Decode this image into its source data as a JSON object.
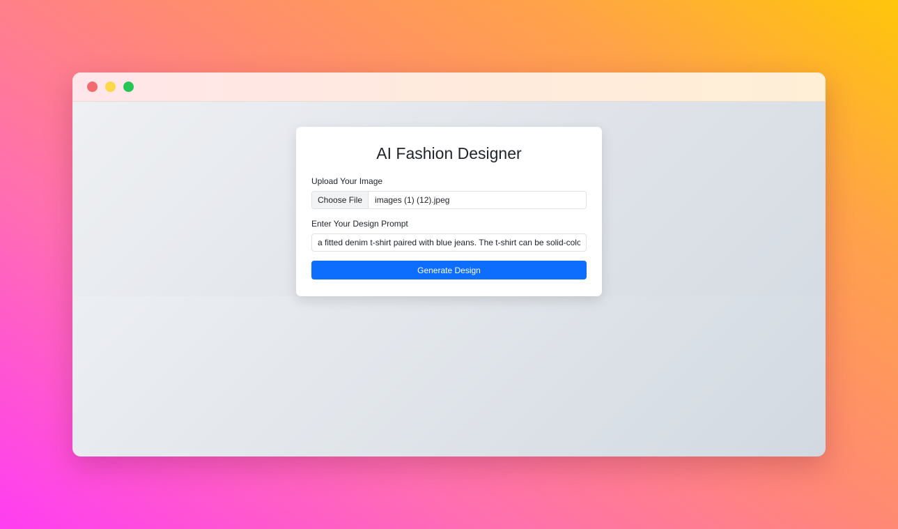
{
  "window": {
    "controls": [
      "close",
      "minimize",
      "maximize"
    ]
  },
  "app": {
    "title": "AI Fashion Designer"
  },
  "form": {
    "upload_label": "Upload Your Image",
    "file_button_label": "Choose File",
    "file_name": "images (1) (12).jpeg",
    "prompt_label": "Enter Your Design Prompt",
    "prompt_value": "a fitted denim t-shirt paired with blue jeans. The t-shirt can be solid-color",
    "generate_label": "Generate Design"
  },
  "colors": {
    "primary": "#0d6efd",
    "close_dot": "#f26b6e",
    "minimize_dot": "#fdd84a",
    "maximize_dot": "#27c456"
  }
}
